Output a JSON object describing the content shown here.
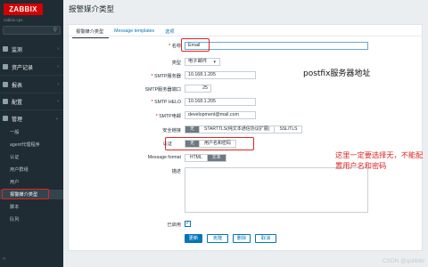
{
  "sidebar": {
    "logo": "ZABBIX",
    "brand_sub": "zabbix-cps",
    "nav": [
      {
        "label": "监测"
      },
      {
        "label": "资产记录"
      },
      {
        "label": "报表"
      },
      {
        "label": "配置"
      },
      {
        "label": "管理"
      }
    ],
    "sub": [
      {
        "label": "一般"
      },
      {
        "label": "agent代理程序"
      },
      {
        "label": "认证"
      },
      {
        "label": "用户群组"
      },
      {
        "label": "用户"
      },
      {
        "label": "报警媒介类型"
      },
      {
        "label": "脚本"
      },
      {
        "label": "队列"
      }
    ]
  },
  "page_title": "报警媒介类型",
  "tabs": [
    "报警媒介类型",
    "Message templates",
    "选项"
  ],
  "form": {
    "name_label": "名称",
    "name_value": "Email",
    "type_label": "类型",
    "type_value": "电子邮件",
    "smtp_server_label": "SMTP服务器",
    "smtp_server_value": "10.168.1.205",
    "smtp_port_label": "SMTP服务器端口",
    "smtp_port_value": "25",
    "smtp_helo_label": "SMTP HELO",
    "smtp_helo_value": "10.168.1.205",
    "smtp_email_label": "SMTP电邮",
    "smtp_email_value": "development@mail.com",
    "security_label": "安全链接",
    "security_options": [
      "无",
      "STARTTLS(纯文本通信协议扩展)",
      "SSL/TLS"
    ],
    "auth_label": "认证",
    "auth_options": [
      "无",
      "用户名和密码"
    ],
    "format_label": "Message format",
    "format_options": [
      "HTML",
      "文本"
    ],
    "desc_label": "描述",
    "enabled_label": "已启用",
    "enabled_check": "✓"
  },
  "buttons": [
    "更新",
    "克隆",
    "删除",
    "取消"
  ],
  "annotations": {
    "postfix": "postfix服务器地址",
    "auth_note": "这里一定要选择无，不能配置用户名和密码"
  },
  "watermark": "CSDN @qulibibi"
}
